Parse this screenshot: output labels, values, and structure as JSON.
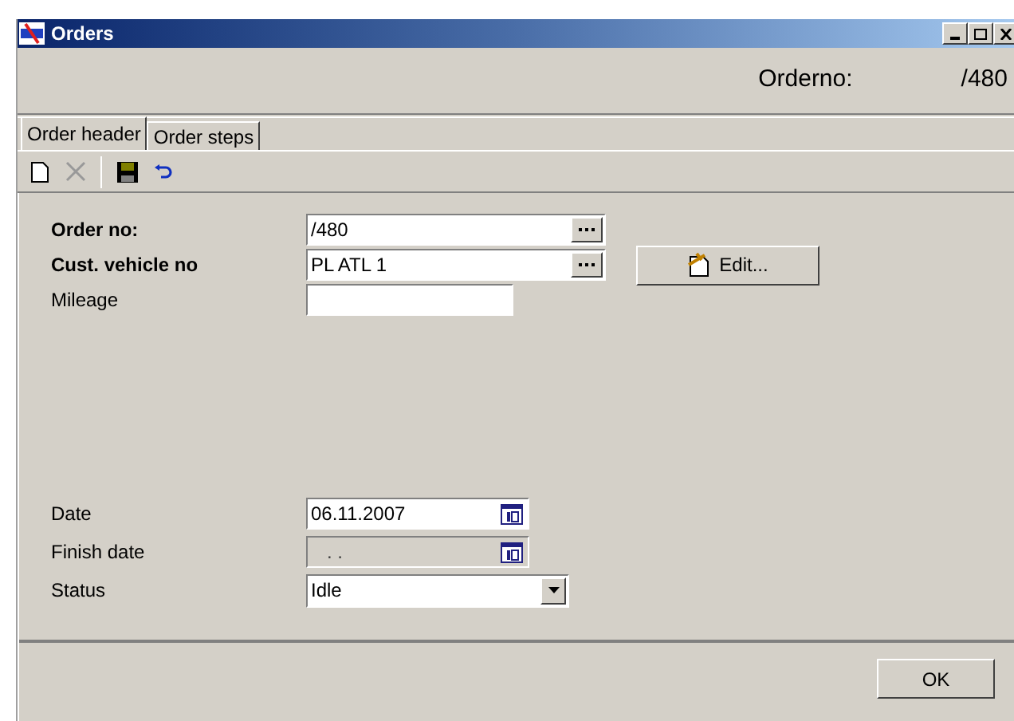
{
  "window": {
    "title": "Orders"
  },
  "header": {
    "label": "Orderno:",
    "value": "/480"
  },
  "tabs": [
    {
      "label": "Order header",
      "selected": true
    },
    {
      "label": "Order steps",
      "selected": false
    }
  ],
  "toolbar": [
    {
      "kind": "new",
      "disabled": false
    },
    {
      "kind": "delete",
      "disabled": true
    },
    {
      "kind": "separator"
    },
    {
      "kind": "save",
      "disabled": false
    },
    {
      "kind": "undo",
      "disabled": false
    }
  ],
  "fields_top": [
    {
      "label": "Order no:",
      "required": true,
      "kind": "lookup",
      "value": "/480",
      "disabled": false
    },
    {
      "label": "Cust. vehicle no",
      "required": true,
      "kind": "lookup",
      "value": "PL ATL 1",
      "disabled": false,
      "button": "Edit..."
    },
    {
      "label": "Mileage",
      "required": false,
      "kind": "text",
      "disabled": false
    }
  ],
  "fields_bottom": [
    {
      "label": "Date",
      "required": false,
      "kind": "date",
      "value": "06.11.2007",
      "disabled": false
    },
    {
      "label": "Finish date",
      "required": false,
      "kind": "date",
      "value": ". .",
      "disabled": true
    },
    {
      "label": "Status",
      "required": false,
      "kind": "select",
      "value": "Idle",
      "disabled": false
    }
  ],
  "buttons": [
    "OK"
  ]
}
